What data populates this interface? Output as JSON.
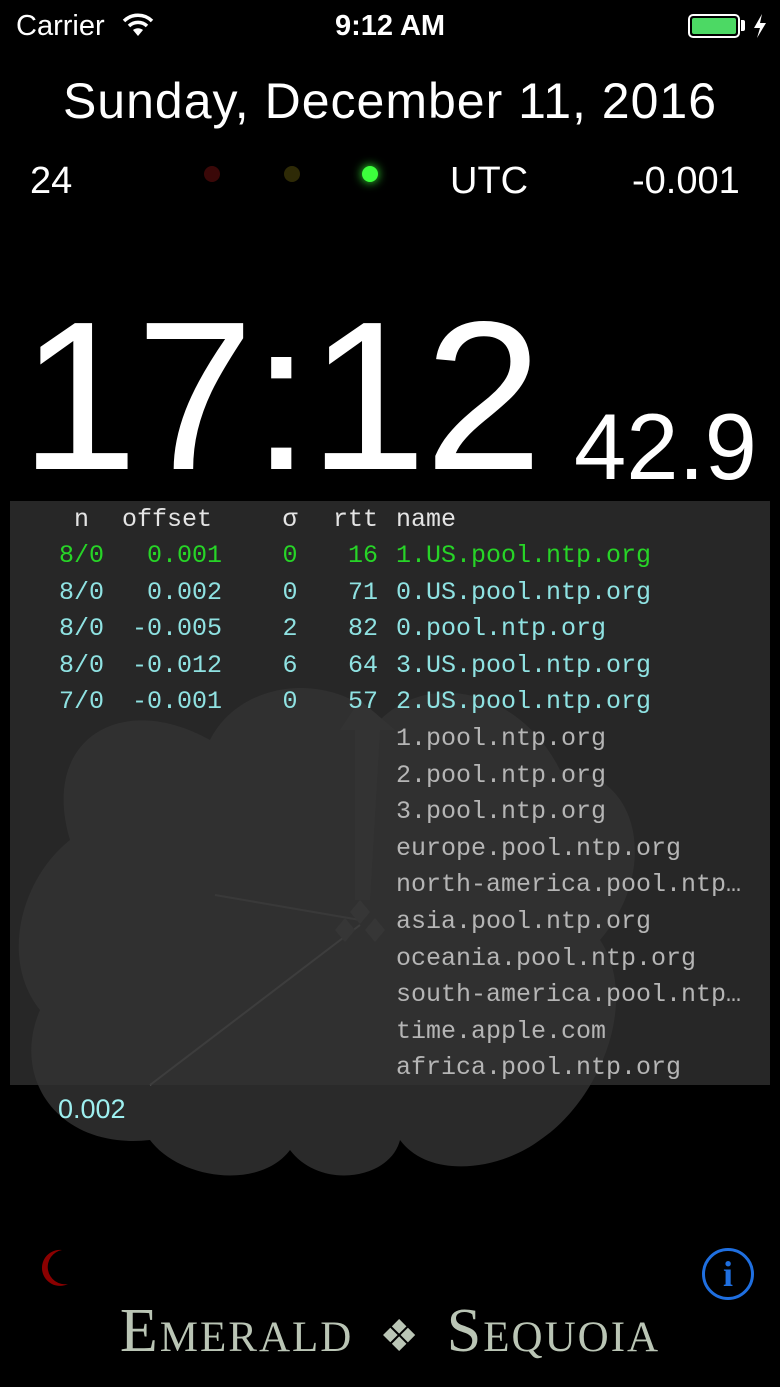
{
  "status_bar": {
    "carrier": "Carrier",
    "time": "9:12 AM",
    "battery_color": "#4cd964"
  },
  "date_line": "Sunday, December 11, 2016",
  "info_row": {
    "day_number": "24",
    "timezone": "UTC",
    "offset": "-0.001"
  },
  "indicators": {
    "red": "#3a0808",
    "amber": "#2e2a06",
    "green": "#3cff3c"
  },
  "clock": {
    "hours_minutes": "17:12",
    "seconds": "42.9"
  },
  "table": {
    "headers": {
      "n": "n",
      "offset": "offset",
      "sigma": "σ",
      "rtt": "rtt",
      "name": "name"
    },
    "rows": [
      {
        "n": "8/0",
        "offset": "0.001",
        "sigma": "0",
        "rtt": "16",
        "name": "1.US.pool.ntp.org"
      },
      {
        "n": "8/0",
        "offset": "0.002",
        "sigma": "0",
        "rtt": "71",
        "name": "0.US.pool.ntp.org"
      },
      {
        "n": "8/0",
        "offset": "-0.005",
        "sigma": "2",
        "rtt": "82",
        "name": "0.pool.ntp.org"
      },
      {
        "n": "8/0",
        "offset": "-0.012",
        "sigma": "6",
        "rtt": "64",
        "name": "3.US.pool.ntp.org"
      },
      {
        "n": "7/0",
        "offset": "-0.001",
        "sigma": "0",
        "rtt": "57",
        "name": "2.US.pool.ntp.org"
      },
      {
        "n": "",
        "offset": "",
        "sigma": "",
        "rtt": "",
        "name": "1.pool.ntp.org"
      },
      {
        "n": "",
        "offset": "",
        "sigma": "",
        "rtt": "",
        "name": "2.pool.ntp.org"
      },
      {
        "n": "",
        "offset": "",
        "sigma": "",
        "rtt": "",
        "name": "3.pool.ntp.org"
      },
      {
        "n": "",
        "offset": "",
        "sigma": "",
        "rtt": "",
        "name": "europe.pool.ntp.org"
      },
      {
        "n": "",
        "offset": "",
        "sigma": "",
        "rtt": "",
        "name": "north-america.pool.ntp…"
      },
      {
        "n": "",
        "offset": "",
        "sigma": "",
        "rtt": "",
        "name": "asia.pool.ntp.org"
      },
      {
        "n": "",
        "offset": "",
        "sigma": "",
        "rtt": "",
        "name": "oceania.pool.ntp.org"
      },
      {
        "n": "",
        "offset": "",
        "sigma": "",
        "rtt": "",
        "name": "south-america.pool.ntp…"
      },
      {
        "n": "",
        "offset": "",
        "sigma": "",
        "rtt": "",
        "name": "time.apple.com"
      },
      {
        "n": "",
        "offset": "",
        "sigma": "",
        "rtt": "",
        "name": "africa.pool.ntp.org"
      }
    ],
    "colors": {
      "selected": "#27d427",
      "active": "#8fe2e2",
      "idle": "#b5b5b5"
    }
  },
  "dial_label": "0.002",
  "brand": {
    "left": "Emerald",
    "separator": "❖",
    "right": "Sequoia"
  },
  "info_button": {
    "label": "i",
    "color": "#1f6fe0"
  },
  "icons": {
    "wifi": "wifi-icon",
    "bolt": "charging-bolt-icon",
    "moon": "moon-icon"
  }
}
